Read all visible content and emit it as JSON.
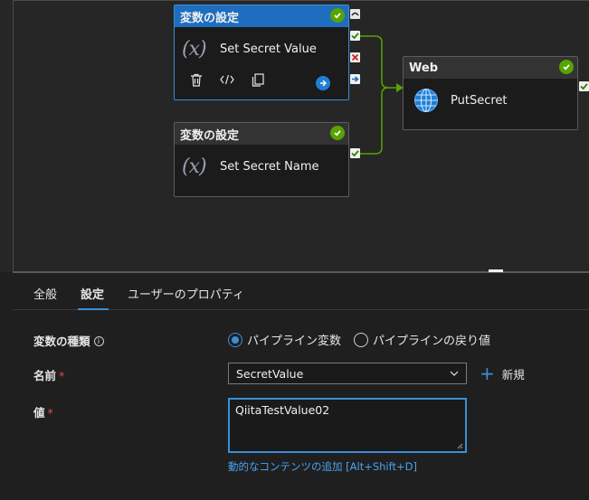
{
  "activities": {
    "set_secret_value": {
      "header": "変数の設定",
      "name": "Set Secret Value",
      "icon": "(x)"
    },
    "set_secret_name": {
      "header": "変数の設定",
      "name": "Set Secret Name",
      "icon": "(x)"
    },
    "web": {
      "header": "Web",
      "name": "PutSecret"
    }
  },
  "tabs": [
    {
      "label": "全般"
    },
    {
      "label": "設定"
    },
    {
      "label": "ユーザーのプロパティ"
    }
  ],
  "form": {
    "variable_type_label": "変数の種類",
    "name_label": "名前",
    "value_label": "値",
    "required_mark": "*",
    "radio_pipeline_variable": "パイプライン変数",
    "radio_pipeline_return": "パイプラインの戻り値",
    "name_selected": "SecretValue",
    "new_label": "新規",
    "value_text": "QiitaTestValue02",
    "dynamic_content_link": "動的なコンテンツの追加 [Alt+Shift+D]"
  },
  "colors": {
    "accent": "#3b8fd6",
    "success": "#57a300",
    "required": "#e0524f"
  }
}
